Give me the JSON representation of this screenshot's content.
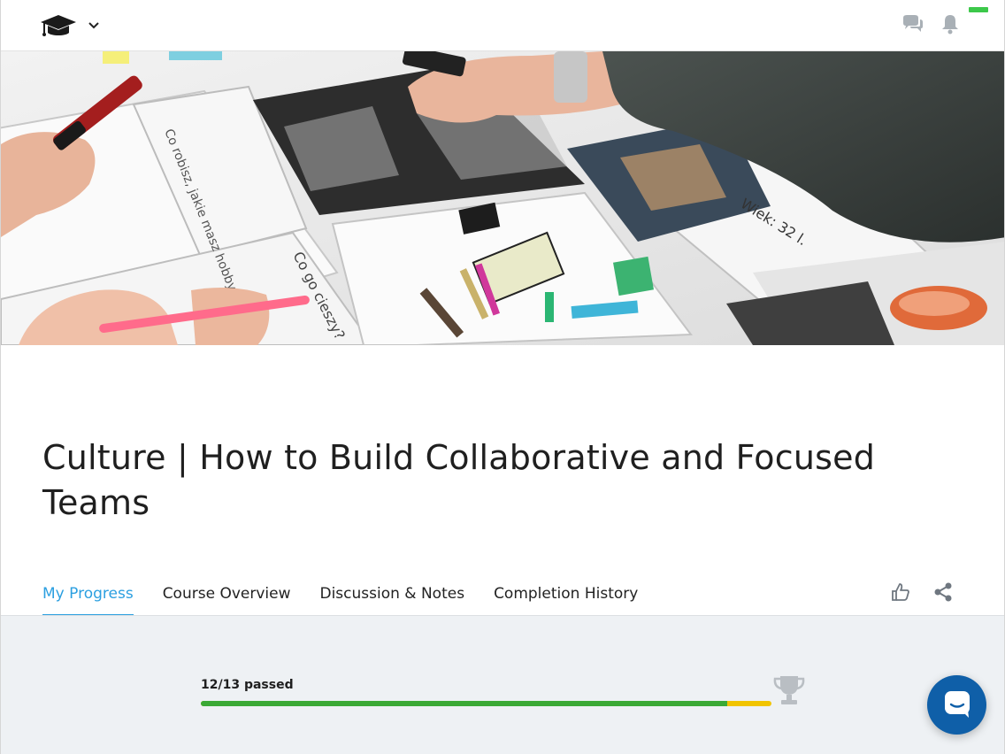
{
  "header": {
    "logo_icon": "graduation-cap-icon",
    "dropdown_icon": "chevron-down-icon",
    "chat_icon": "chat-bubbles-icon",
    "notification_icon": "bell-icon",
    "status_color": "#3cc84a"
  },
  "hero": {
    "image": "team-collaboration-photo",
    "handwritten_texts": [
      "Co robisz, jakie masz hobby?",
      "Co go cieszy?",
      "Wiek: 32 l."
    ]
  },
  "course": {
    "title": "Culture | How to Build Collaborative and Focused Teams"
  },
  "tabs": [
    {
      "label": "My Progress",
      "active": true
    },
    {
      "label": "Course Overview",
      "active": false
    },
    {
      "label": "Discussion & Notes",
      "active": false
    },
    {
      "label": "Completion History",
      "active": false
    }
  ],
  "tab_actions": {
    "like_icon": "thumbs-up-icon",
    "share_icon": "share-icon"
  },
  "progress": {
    "label": "12/13 passed",
    "passed": 12,
    "total": 13,
    "fraction_passed": 0.923,
    "passed_color": "#3aa935",
    "remaining_color": "#f1c400",
    "trophy_icon": "trophy-icon"
  },
  "chat_fab": {
    "icon": "chat-message-icon",
    "color": "#0f5fa8"
  },
  "colors": {
    "accent": "#2b9fe0",
    "progress_bg": "#eef1f4"
  }
}
